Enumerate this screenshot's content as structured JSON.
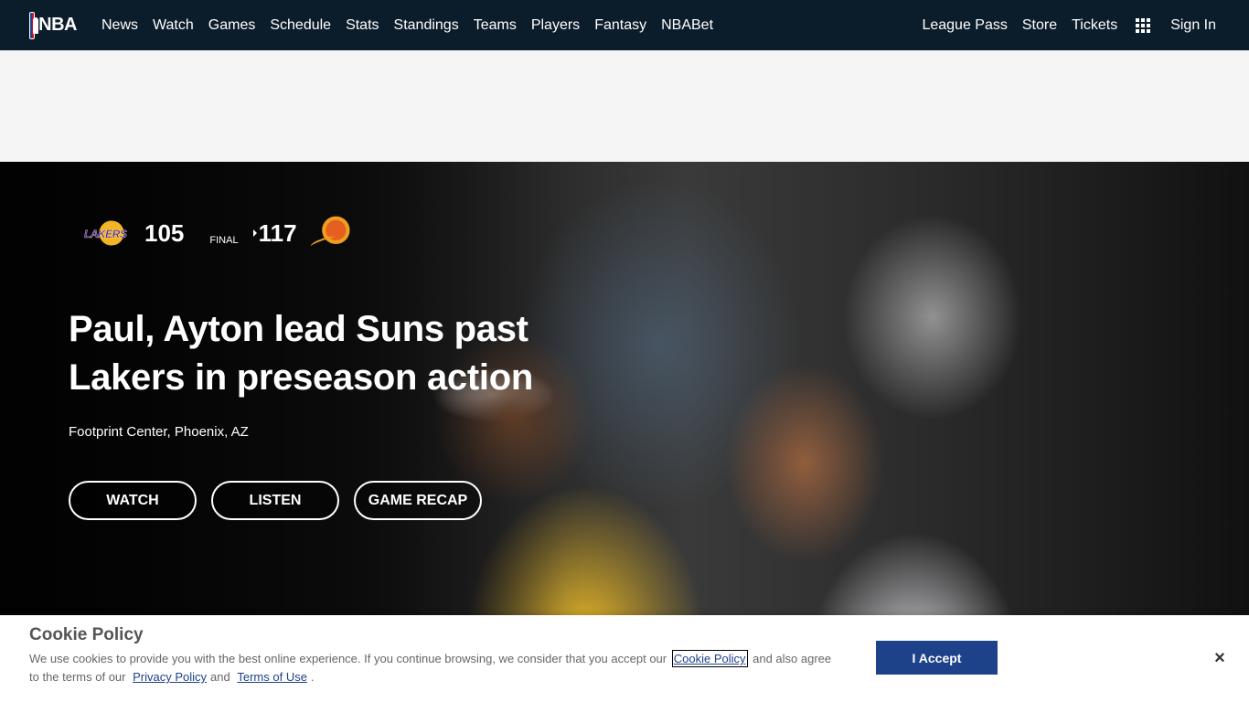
{
  "nav": {
    "logo": "NBA",
    "links": [
      "News",
      "Watch",
      "Games",
      "Schedule",
      "Stats",
      "Standings",
      "Teams",
      "Players",
      "Fantasy",
      "NBABet"
    ],
    "right": {
      "league_pass": "League Pass",
      "store": "Store",
      "tickets": "Tickets",
      "apps_icon": "grid-icon",
      "sign_in": "Sign In"
    }
  },
  "hero": {
    "away": {
      "logo_text": "LAKERS",
      "score": "105"
    },
    "status": "FINAL",
    "home": {
      "score": "117",
      "logo": "suns-logo"
    },
    "headline": "Paul, Ayton lead Suns past Lakers in preseason action",
    "venue": "Footprint Center, Phoenix, AZ",
    "buttons": {
      "watch": "WATCH",
      "listen": "LISTEN",
      "recap": "GAME RECAP"
    }
  },
  "cookie": {
    "title": "Cookie Policy",
    "text_1": "We use cookies to provide you with the best online experience. If you continue browsing, we consider that you accept our",
    "cookie_link": "Cookie Policy",
    "text_2": "and also agree to the terms of our",
    "privacy_link": "Privacy Policy",
    "and": "and",
    "terms_link": "Terms of Use",
    "period": ".",
    "accept": "I Accept",
    "close": "×"
  },
  "colors": {
    "nav_bg": "#0b1c2b",
    "accent": "#1d428a"
  }
}
